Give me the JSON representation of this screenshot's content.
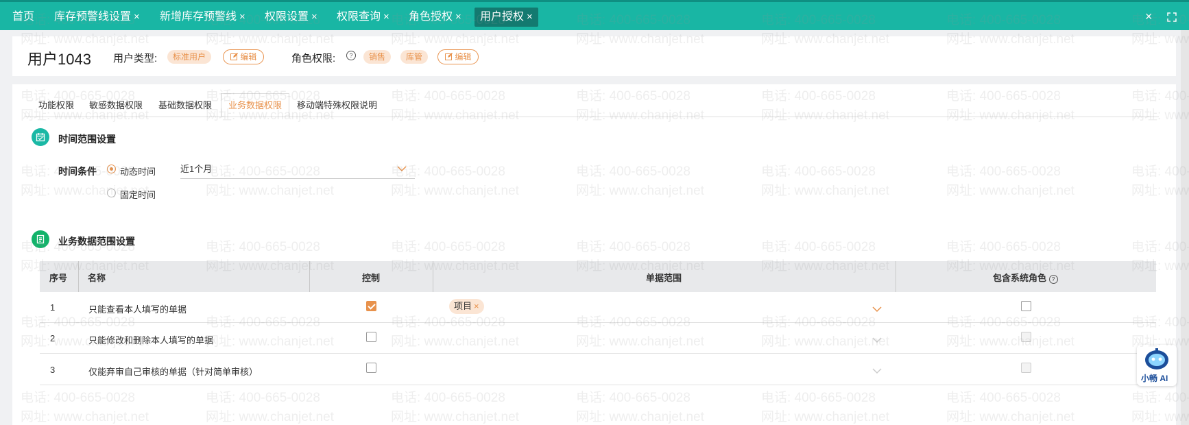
{
  "top_tabs": [
    {
      "label": "首页",
      "closable": false
    },
    {
      "label": "库存预警线设置",
      "closable": true
    },
    {
      "label": "新增库存预警线",
      "closable": true
    },
    {
      "label": "权限设置",
      "closable": true
    },
    {
      "label": "权限查询",
      "closable": true
    },
    {
      "label": "角色授权",
      "closable": true
    },
    {
      "label": "用户授权",
      "closable": true,
      "active": true
    }
  ],
  "close_glyph": "×",
  "header": {
    "user_name": "用户1043",
    "user_type_label": "用户类型:",
    "user_type_tag": "标准用户",
    "edit_label": "编辑",
    "role_label": "角色权限:",
    "role_tags": [
      "销售",
      "库管"
    ]
  },
  "sub_tabs": [
    "功能权限",
    "敏感数据权限",
    "基础数据权限",
    "业务数据权限",
    "移动端特殊权限说明"
  ],
  "active_sub_tab": "业务数据权限",
  "time_section": {
    "title": "时间范围设置",
    "condition_label": "时间条件",
    "options": [
      {
        "label": "动态时间",
        "selected": true
      },
      {
        "label": "固定时间",
        "selected": false
      }
    ],
    "select_value": "近1个月"
  },
  "business_section": {
    "title": "业务数据范围设置",
    "columns": [
      "序号",
      "名称",
      "控制",
      "单据范围",
      "包含系统角色"
    ],
    "rows": [
      {
        "index": "1",
        "name": "只能查看本人填写的单据",
        "control": true,
        "scope": [
          "项目"
        ],
        "include_system_role": false
      },
      {
        "index": "2",
        "name": "只能修改和删除本人填写的单据",
        "control": false,
        "scope": [],
        "include_system_role": false
      },
      {
        "index": "3",
        "name": "仅能弃审自己审核的单据（针对简单审核）",
        "control": false,
        "scope": [],
        "include_system_role": false
      }
    ]
  },
  "watermark": {
    "phone": "电话: 400-665-0028",
    "site": "网址: www.chanjet.net"
  },
  "ai_assistant": {
    "label": "小畅 AI"
  },
  "colors": {
    "brand": "#19b6a4",
    "brand_dark": "#137a70",
    "accent": "#e8924c",
    "tag_bg": "#fbe5d4",
    "section_icon_1": "#1ab8a5",
    "section_icon_2": "#12b36a"
  },
  "icons": {
    "close_window": "close-icon",
    "fullscreen": "fullscreen-icon",
    "edit": "edit-icon",
    "help": "question-circle-icon",
    "calendar": "calendar-icon",
    "document": "document-icon",
    "dropdown": "chevron-down-icon"
  }
}
